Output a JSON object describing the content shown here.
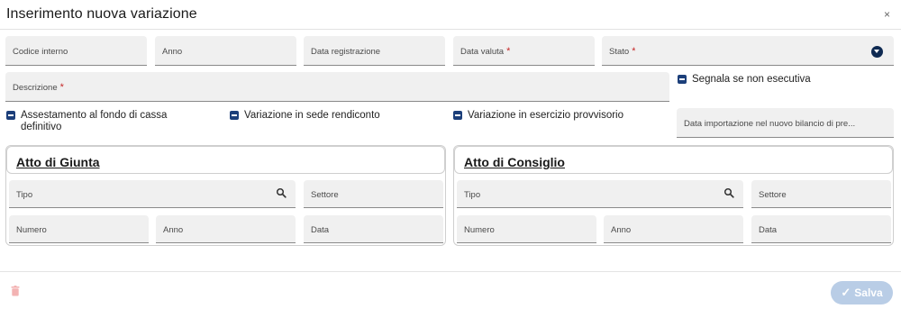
{
  "dialog": {
    "title": "Inserimento nuova variazione",
    "close_glyph": "×"
  },
  "fields": {
    "codice_interno": "Codice interno",
    "anno": "Anno",
    "data_registrazione": "Data registrazione",
    "data_valuta": "Data valuta",
    "stato": "Stato",
    "descrizione": "Descrizione",
    "data_importazione": "Data importazione nel nuovo bilancio di pre..."
  },
  "required_mark": "*",
  "checkboxes": {
    "segnala": "Segnala se non esecutiva",
    "assestamento": "Assestamento al fondo di cassa definitivo",
    "rendiconto": "Variazione in sede rendiconto",
    "provvisorio": "Variazione in esercizio provvisorio"
  },
  "atto_giunta": {
    "title": "Atto di Giunta",
    "tipo": "Tipo",
    "settore": "Settore",
    "numero": "Numero",
    "anno": "Anno",
    "data": "Data"
  },
  "atto_consiglio": {
    "title": "Atto di Consiglio",
    "tipo": "Tipo",
    "settore": "Settore",
    "numero": "Numero",
    "anno": "Anno",
    "data": "Data"
  },
  "footer": {
    "save_label": "Salva",
    "save_check": "✓"
  },
  "colors": {
    "accent": "#1c3f7a",
    "required": "#c62828",
    "delete_icon": "#f3b3b3",
    "save_disabled": "#b9cde6"
  },
  "icons": [
    "close-icon",
    "chevron-down-icon",
    "search-icon",
    "trash-icon",
    "check-icon"
  ]
}
